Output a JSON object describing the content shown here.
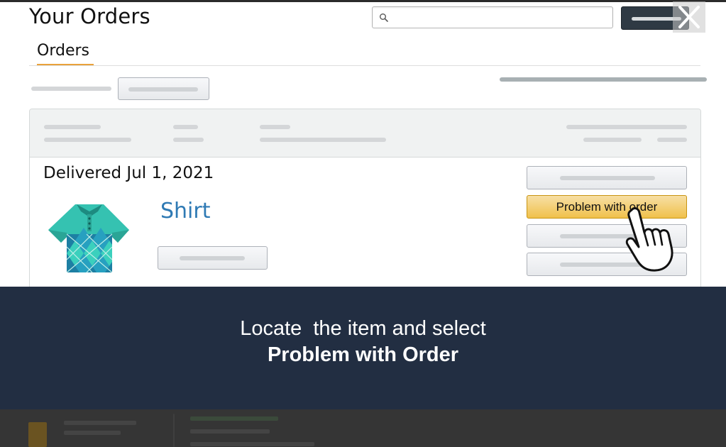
{
  "header": {
    "title": "Your Orders",
    "search_placeholder": ""
  },
  "tabs": [
    {
      "label": "Orders",
      "active": true
    }
  ],
  "order": {
    "status": "Delivered Jul 1, 2021",
    "product_name": "Shirt",
    "actions": {
      "problem_label": "Problem with order"
    }
  },
  "instruction": {
    "line1": "Locate  the item and select",
    "line2": "Problem with Order"
  },
  "colors": {
    "accent_button": "#f0c14b",
    "link": "#2f7ab4",
    "overlay": "#222e42",
    "tab_underline": "#e9a23b"
  },
  "icons": [
    "search-icon",
    "close-icon",
    "shirt-icon",
    "pointer-hand-icon"
  ]
}
